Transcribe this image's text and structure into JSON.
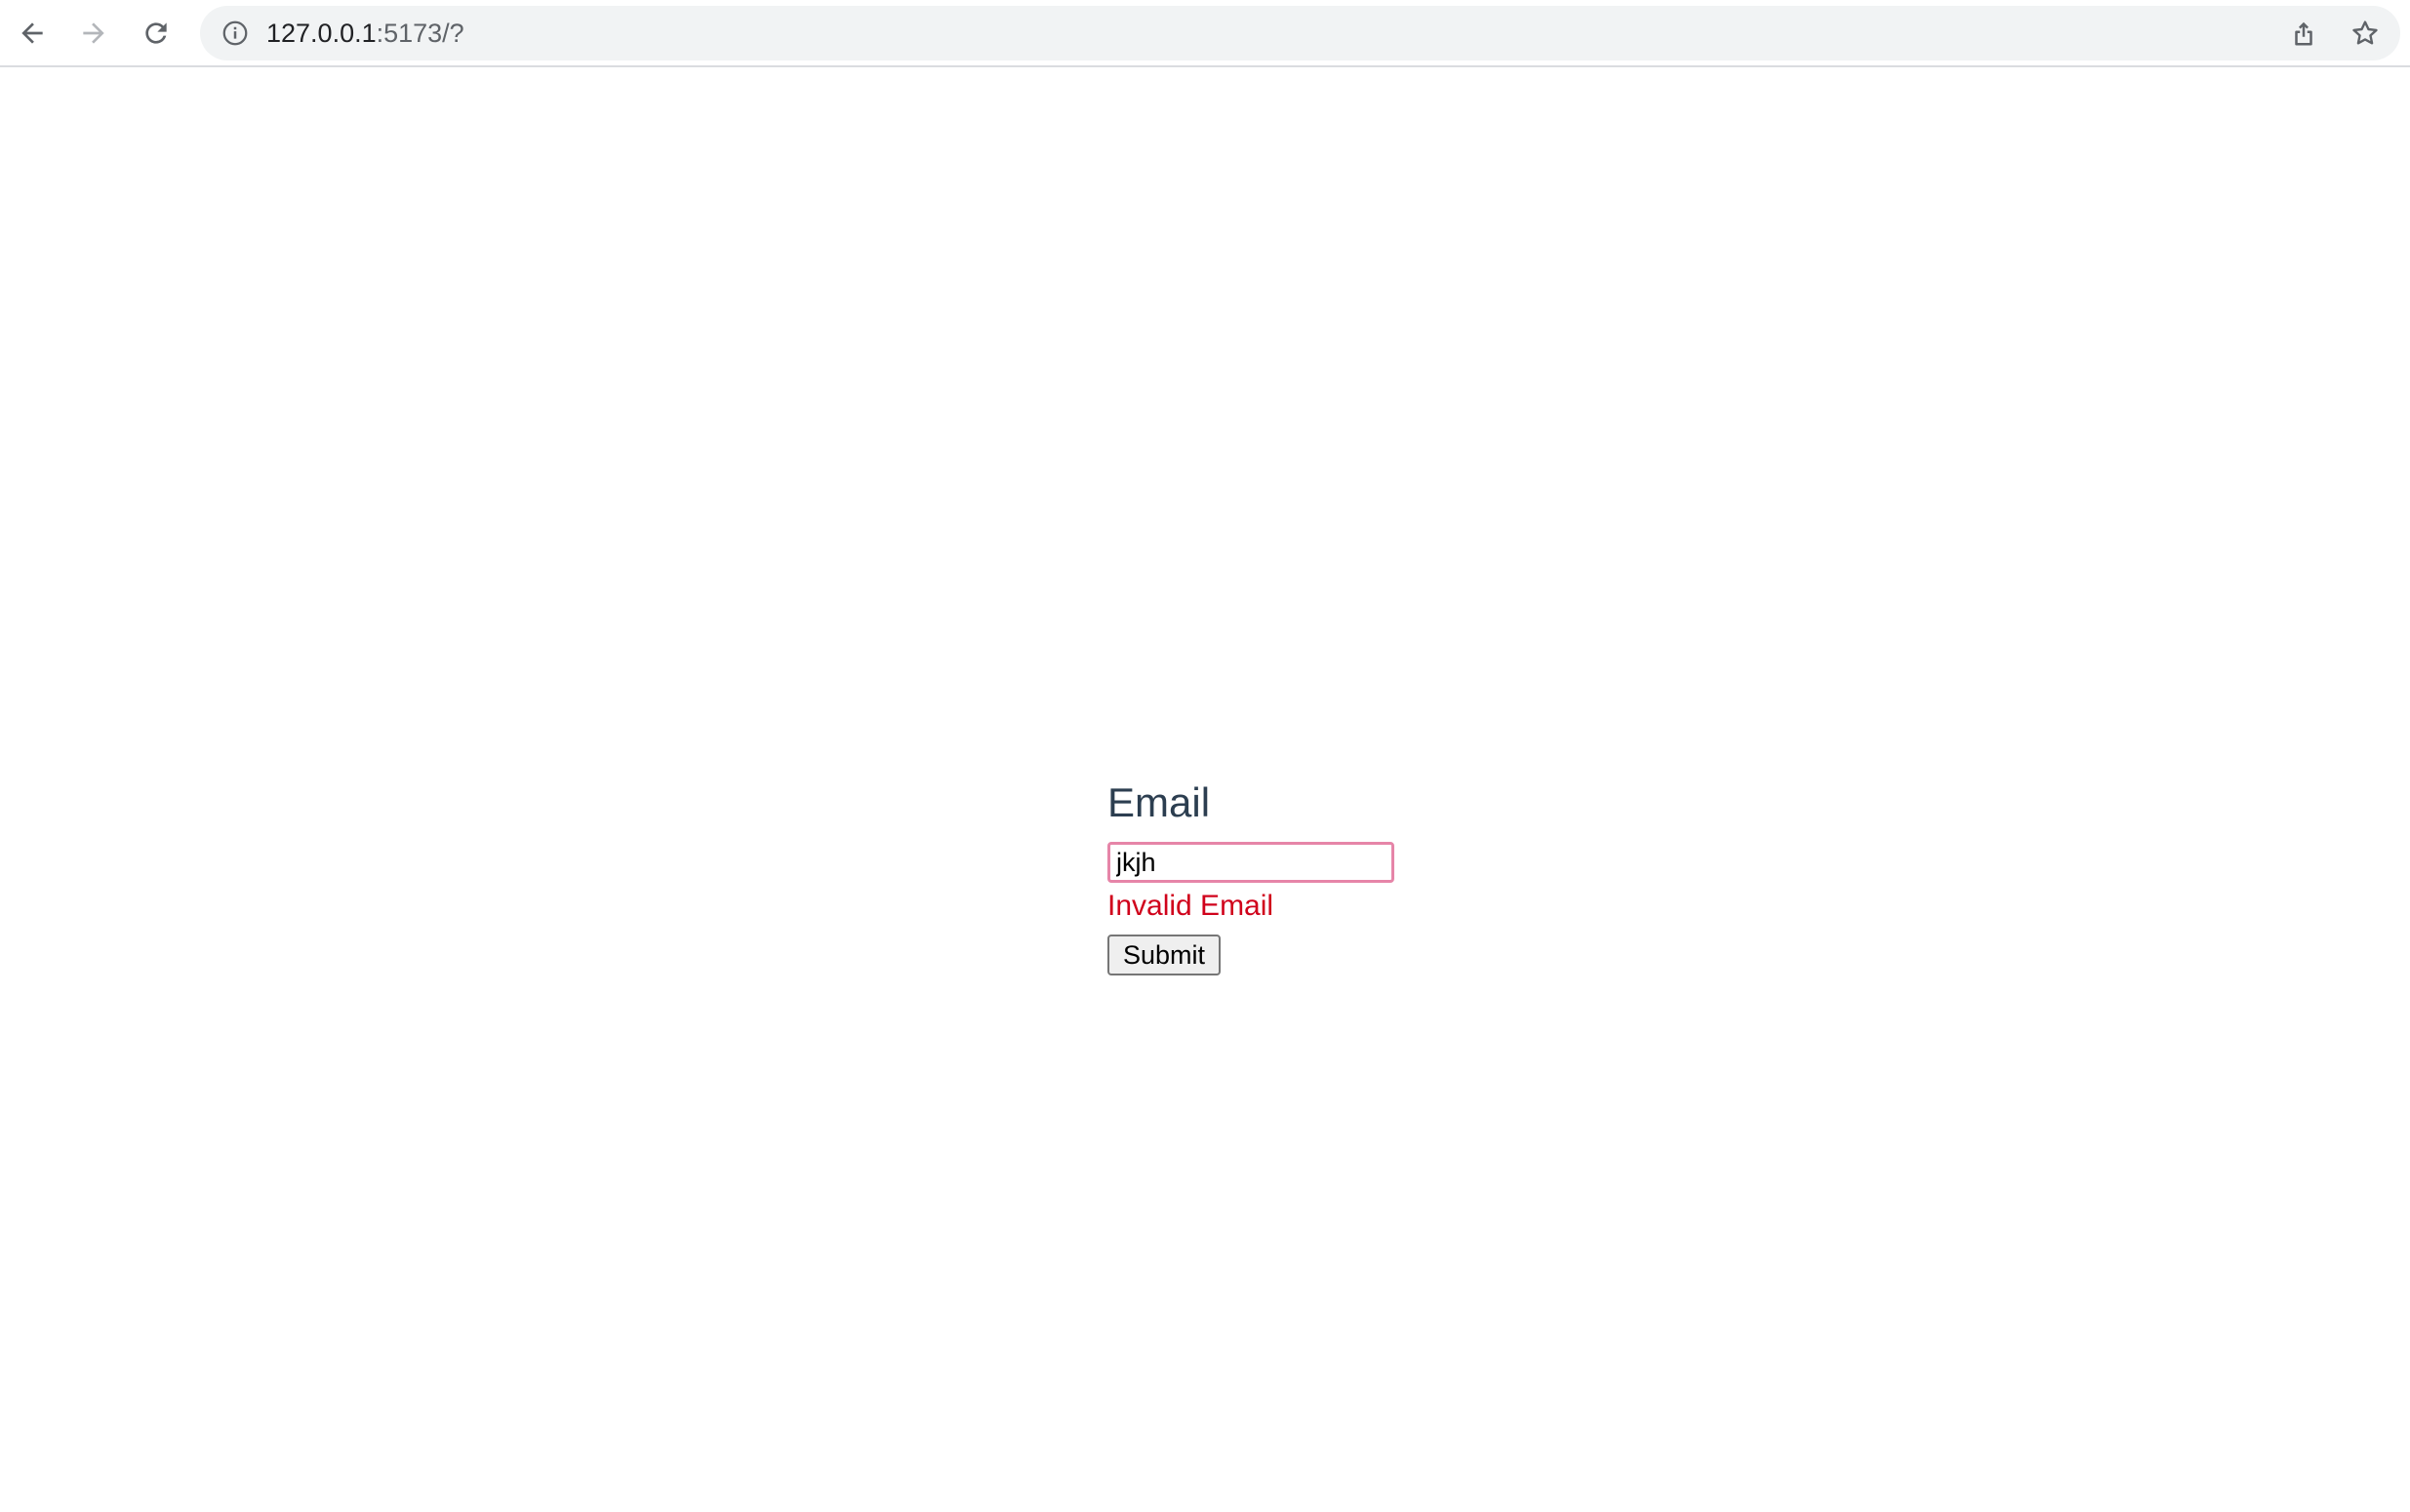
{
  "browser": {
    "url_host": "127.0.0.1",
    "url_rest": ":5173/?",
    "icons": {
      "back": "back-arrow-icon",
      "forward": "forward-arrow-icon",
      "reload": "reload-icon",
      "site_info": "info-icon",
      "share": "share-icon",
      "bookmark": "star-icon"
    }
  },
  "form": {
    "label": "Email",
    "input_value": "jkjh",
    "error": "Invalid Email",
    "submit_label": "Submit"
  },
  "colors": {
    "label": "#2c3e50",
    "error": "#d0021b",
    "input_border": "#e685a8",
    "omnibox_bg": "#f1f3f4"
  }
}
